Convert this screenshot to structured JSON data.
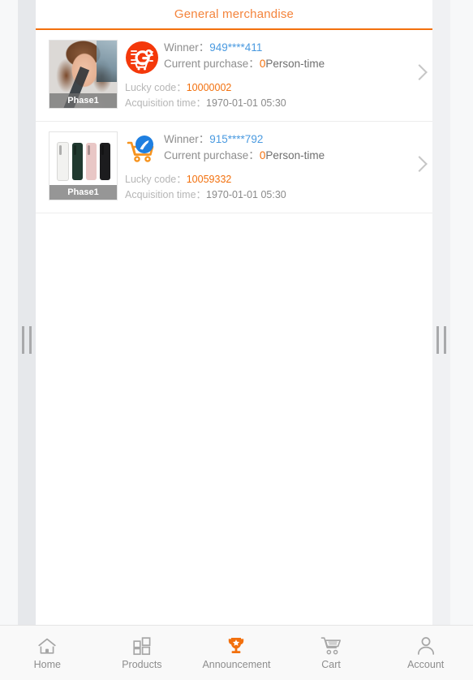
{
  "header": {
    "title": "General merchandise",
    "accent_color": "#f2700d",
    "title_color": "#f4843c"
  },
  "labels": {
    "winner": "Winner：",
    "current_purchase": "Current purchase：",
    "person_time": "Person-time",
    "lucky_code": "Lucky code：",
    "acquisition_time": "Acquisition time："
  },
  "colors": {
    "winner_value": "#4a9ae0",
    "count_value": "#f2700d",
    "lucky_code_value": "#f2700d",
    "label_gray": "#8e8e8e",
    "subtle_gray": "#b6b6b6"
  },
  "announcements": [
    {
      "thumbnail_kind": "person-photo",
      "phase_badge": "Phase1",
      "brand_icon": "go-cart-icon",
      "winner": "949****411",
      "current_purchase": "0",
      "lucky_code": "10000002",
      "acquisition_time": "1970-01-01 05:30",
      "chevron": "chevron-right-icon"
    },
    {
      "thumbnail_kind": "phone-lineup",
      "phase_badge": "Phase1",
      "brand_icon": "blue-badge-cart-icon",
      "winner": "915****792",
      "current_purchase": "0",
      "lucky_code": "10059332",
      "acquisition_time": "1970-01-01 05:30",
      "chevron": "chevron-right-icon"
    }
  ],
  "tabbar": {
    "items": [
      {
        "label": "Home",
        "icon": "home-icon",
        "active": false
      },
      {
        "label": "Products",
        "icon": "grid-icon",
        "active": false
      },
      {
        "label": "Announcement",
        "icon": "trophy-icon",
        "active": true
      },
      {
        "label": "Cart",
        "icon": "shopping-cart-icon",
        "active": false
      },
      {
        "label": "Account",
        "icon": "person-icon",
        "active": false
      }
    ],
    "active_color": "#f2700d",
    "inactive_color": "#9b9b9b"
  }
}
